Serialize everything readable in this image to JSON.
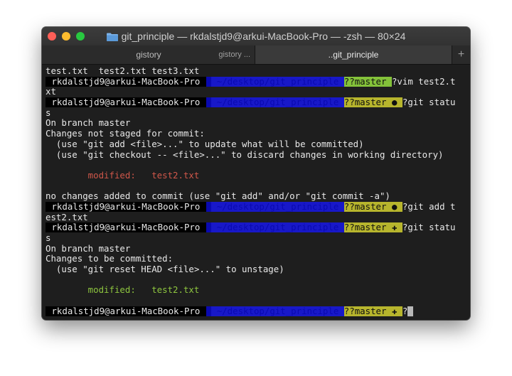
{
  "window": {
    "title": "git_principle — rkdalstjd9@arkui-MacBook-Pro — -zsh — 80×24",
    "lights": {
      "close": "#fe5f57",
      "minimize": "#febc2e",
      "zoom": "#28c840"
    }
  },
  "tabs": [
    {
      "label": "gistory",
      "sub": "gistory ..."
    },
    {
      "label": "..git_principle"
    }
  ],
  "new_tab_label": "+",
  "prompt": {
    "user": " rkdalstjd9@arkui-MacBook-Pro ",
    "glyph": "?",
    "path": " ~/desktop/git_principle ",
    "branch": "master",
    "dirty_mark": "●",
    "staged_mark": "✚"
  },
  "lines": [
    {
      "text": "test.txt  test2.txt test3.txt"
    },
    {
      "cmd": "vim test2.t"
    },
    {
      "text": "xt"
    },
    {
      "cmd": "git statu"
    },
    {
      "text": "s"
    },
    {
      "text": "On branch master"
    },
    {
      "text": "Changes not staged for commit:"
    },
    {
      "text": "  (use \"git add <file>...\" to update what will be committed)"
    },
    {
      "text": "  (use \"git checkout -- <file>...\" to discard changes in working directory)"
    },
    {
      "text": ""
    },
    {
      "text": "        modified:   test2.txt"
    },
    {
      "text": ""
    },
    {
      "text": "no changes added to commit (use \"git add\" and/or \"git commit -a\")"
    },
    {
      "cmd": "git add t"
    },
    {
      "text": "est2.txt"
    },
    {
      "cmd": "git statu"
    },
    {
      "text": "s"
    },
    {
      "text": "On branch master"
    },
    {
      "text": "Changes to be committed:"
    },
    {
      "text": "  (use \"git reset HEAD <file>...\" to unstage)"
    },
    {
      "text": ""
    },
    {
      "text": "        modified:   test2.txt"
    },
    {
      "text": ""
    }
  ]
}
